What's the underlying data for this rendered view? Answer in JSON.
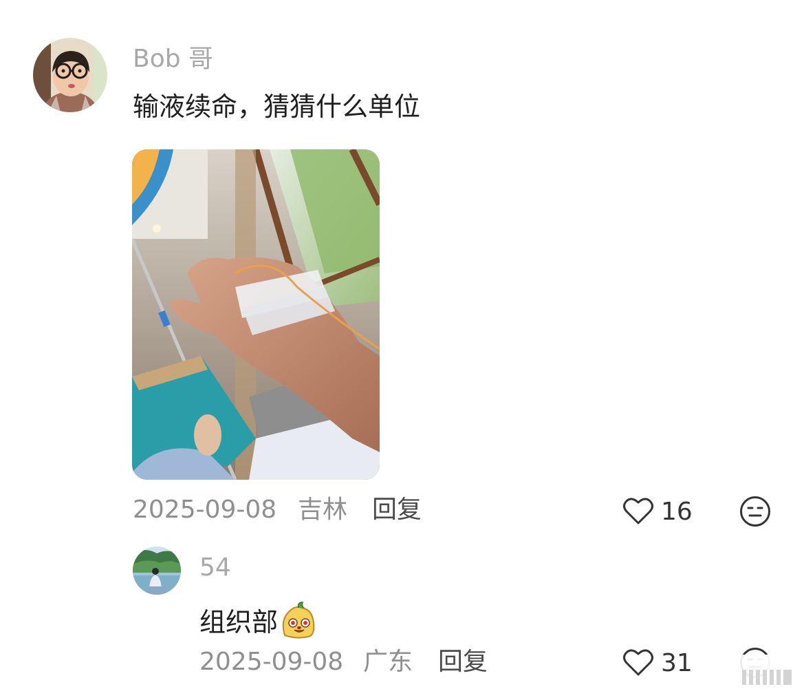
{
  "comments": [
    {
      "username": "Bob 哥",
      "text": "输液续命，猜猜什么单位",
      "date": "2025-09-08",
      "location": "吉林",
      "reply_label": "回复",
      "likes": "16",
      "icons": {
        "like": "heart-outline-icon",
        "dislike": "neutral-face-icon"
      }
    },
    {
      "username": "54",
      "text": "组织部",
      "emoji": "blob-face-emoji",
      "date": "2025-09-08",
      "location": "广东",
      "reply_label": "回复",
      "likes": "31",
      "icons": {
        "like": "heart-outline-icon",
        "dislike": "neutral-face-icon"
      }
    }
  ],
  "colors": {
    "username": "#a8a8a8",
    "text": "#1f1f1f",
    "meta": "#8f8f8f",
    "reply": "#4a4a4a"
  }
}
